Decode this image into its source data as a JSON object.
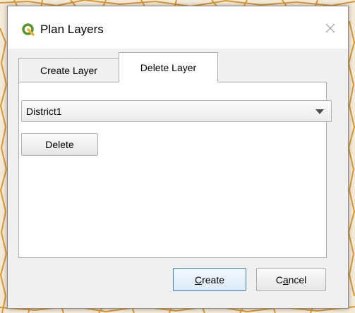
{
  "dialog": {
    "title": "Plan Layers",
    "app_icon": "qgis-logo-icon",
    "close_icon": "close-icon"
  },
  "tabs": [
    {
      "label": "Create Layer",
      "active": false
    },
    {
      "label": "Delete Layer",
      "active": true
    }
  ],
  "delete_panel": {
    "layer_select_value": "District1",
    "delete_label": "Delete",
    "dropdown_icon": "chevron-down-icon"
  },
  "footer": {
    "create_label": "Create",
    "create_mnemonic": "C",
    "cancel_label": "Cancel",
    "cancel_mnemonic": "a"
  },
  "colors": {
    "map_lines": "#d9901e",
    "map_background": "#f3ead9",
    "dialog_background": "#f0f0f0",
    "qgis_green": "#589632",
    "qgis_yellow": "#f0b12c",
    "default_button_border": "#3c7fb1"
  }
}
